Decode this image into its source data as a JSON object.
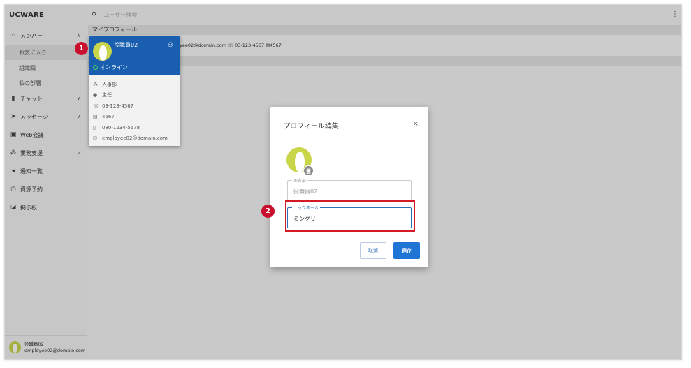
{
  "app": {
    "brand": "UCWARE"
  },
  "sidebar": {
    "items": [
      {
        "label": "メンバー",
        "icon": "members-icon",
        "chev": "∧"
      },
      {
        "label": "お気に入り",
        "sub": true,
        "active": true
      },
      {
        "label": "組織図",
        "sub": true
      },
      {
        "label": "私の部署",
        "sub": true
      },
      {
        "label": "チャット",
        "icon": "chat-icon",
        "chev": "∨"
      },
      {
        "label": "メッセージ",
        "icon": "message-icon",
        "chev": "∨"
      },
      {
        "label": "Web会議",
        "icon": "video-icon"
      },
      {
        "label": "業務支援",
        "icon": "group-icon",
        "chev": "∨"
      },
      {
        "label": "通知一覧",
        "icon": "megaphone-icon"
      },
      {
        "label": "資源予約",
        "icon": "clock-icon"
      },
      {
        "label": "掲示板",
        "icon": "board-icon"
      }
    ],
    "footer": {
      "name": "役職員02",
      "email": "employee02@domain.com"
    }
  },
  "search": {
    "placeholder": "ユーザー検索"
  },
  "main": {
    "section_title": "マイプロフィール",
    "profile_row_text": "yee02@domain.com  ☏ 03-123-4567  ▤4567"
  },
  "popup": {
    "name": "役職員02",
    "status": "オンライン",
    "department": "人事部",
    "position": "主任",
    "phone": "03-123-4567",
    "extension": "4567",
    "mobile": "080-1234-5678",
    "email": "employee02@domain.com"
  },
  "markers": {
    "one": "1",
    "two": "2"
  },
  "modal": {
    "title": "プロフィール編集",
    "close": "×",
    "name_label": "お名前",
    "name_value": "役職員02",
    "nickname_label": "ニックネーム",
    "nickname_value": "ミングリ",
    "cancel": "取消",
    "save": "保存"
  },
  "colors": {
    "accent": "#1f75d6",
    "popup_header": "#1a5faf",
    "marker": "#c8102e",
    "highlight": "#d41b25"
  }
}
